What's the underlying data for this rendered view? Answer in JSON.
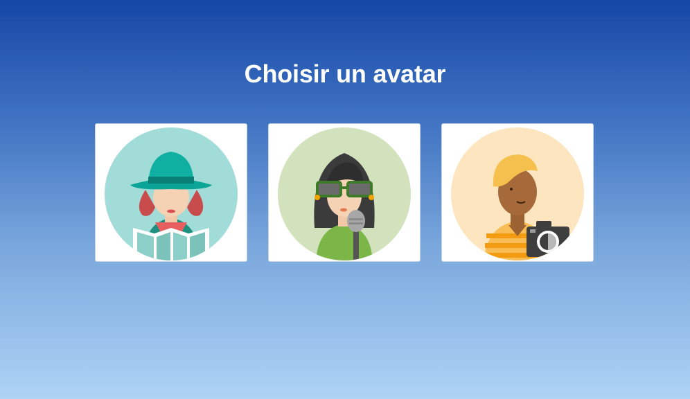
{
  "page": {
    "title": "Choisir un avatar",
    "background_colors": [
      "#1547a6",
      "#aed3f5"
    ]
  },
  "avatars": [
    {
      "icon": "traveler-avatar-icon",
      "circle_color": "#a2dcd8",
      "accent": "#0f9e93"
    },
    {
      "icon": "singer-avatar-icon",
      "circle_color": "#d2e2bd",
      "accent": "#7cb548"
    },
    {
      "icon": "photographer-avatar-icon",
      "circle_color": "#fde6bf",
      "accent": "#f8be55"
    }
  ]
}
